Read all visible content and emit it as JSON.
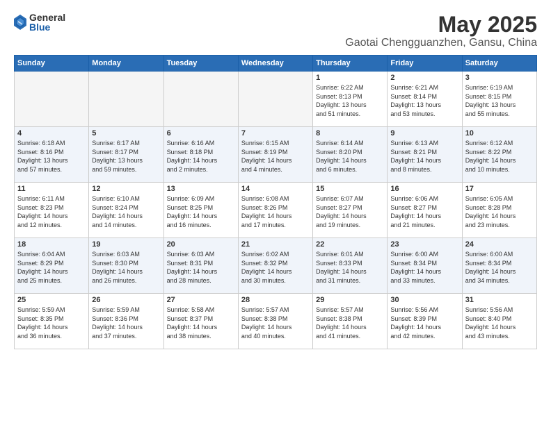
{
  "logo": {
    "general": "General",
    "blue": "Blue"
  },
  "title": "May 2025",
  "location": "Gaotai Chengguanzhen, Gansu, China",
  "headers": [
    "Sunday",
    "Monday",
    "Tuesday",
    "Wednesday",
    "Thursday",
    "Friday",
    "Saturday"
  ],
  "weeks": [
    [
      {
        "day": "",
        "content": ""
      },
      {
        "day": "",
        "content": ""
      },
      {
        "day": "",
        "content": ""
      },
      {
        "day": "",
        "content": ""
      },
      {
        "day": "1",
        "content": "Sunrise: 6:22 AM\nSunset: 8:13 PM\nDaylight: 13 hours\nand 51 minutes."
      },
      {
        "day": "2",
        "content": "Sunrise: 6:21 AM\nSunset: 8:14 PM\nDaylight: 13 hours\nand 53 minutes."
      },
      {
        "day": "3",
        "content": "Sunrise: 6:19 AM\nSunset: 8:15 PM\nDaylight: 13 hours\nand 55 minutes."
      }
    ],
    [
      {
        "day": "4",
        "content": "Sunrise: 6:18 AM\nSunset: 8:16 PM\nDaylight: 13 hours\nand 57 minutes."
      },
      {
        "day": "5",
        "content": "Sunrise: 6:17 AM\nSunset: 8:17 PM\nDaylight: 13 hours\nand 59 minutes."
      },
      {
        "day": "6",
        "content": "Sunrise: 6:16 AM\nSunset: 8:18 PM\nDaylight: 14 hours\nand 2 minutes."
      },
      {
        "day": "7",
        "content": "Sunrise: 6:15 AM\nSunset: 8:19 PM\nDaylight: 14 hours\nand 4 minutes."
      },
      {
        "day": "8",
        "content": "Sunrise: 6:14 AM\nSunset: 8:20 PM\nDaylight: 14 hours\nand 6 minutes."
      },
      {
        "day": "9",
        "content": "Sunrise: 6:13 AM\nSunset: 8:21 PM\nDaylight: 14 hours\nand 8 minutes."
      },
      {
        "day": "10",
        "content": "Sunrise: 6:12 AM\nSunset: 8:22 PM\nDaylight: 14 hours\nand 10 minutes."
      }
    ],
    [
      {
        "day": "11",
        "content": "Sunrise: 6:11 AM\nSunset: 8:23 PM\nDaylight: 14 hours\nand 12 minutes."
      },
      {
        "day": "12",
        "content": "Sunrise: 6:10 AM\nSunset: 8:24 PM\nDaylight: 14 hours\nand 14 minutes."
      },
      {
        "day": "13",
        "content": "Sunrise: 6:09 AM\nSunset: 8:25 PM\nDaylight: 14 hours\nand 16 minutes."
      },
      {
        "day": "14",
        "content": "Sunrise: 6:08 AM\nSunset: 8:26 PM\nDaylight: 14 hours\nand 17 minutes."
      },
      {
        "day": "15",
        "content": "Sunrise: 6:07 AM\nSunset: 8:27 PM\nDaylight: 14 hours\nand 19 minutes."
      },
      {
        "day": "16",
        "content": "Sunrise: 6:06 AM\nSunset: 8:27 PM\nDaylight: 14 hours\nand 21 minutes."
      },
      {
        "day": "17",
        "content": "Sunrise: 6:05 AM\nSunset: 8:28 PM\nDaylight: 14 hours\nand 23 minutes."
      }
    ],
    [
      {
        "day": "18",
        "content": "Sunrise: 6:04 AM\nSunset: 8:29 PM\nDaylight: 14 hours\nand 25 minutes."
      },
      {
        "day": "19",
        "content": "Sunrise: 6:03 AM\nSunset: 8:30 PM\nDaylight: 14 hours\nand 26 minutes."
      },
      {
        "day": "20",
        "content": "Sunrise: 6:03 AM\nSunset: 8:31 PM\nDaylight: 14 hours\nand 28 minutes."
      },
      {
        "day": "21",
        "content": "Sunrise: 6:02 AM\nSunset: 8:32 PM\nDaylight: 14 hours\nand 30 minutes."
      },
      {
        "day": "22",
        "content": "Sunrise: 6:01 AM\nSunset: 8:33 PM\nDaylight: 14 hours\nand 31 minutes."
      },
      {
        "day": "23",
        "content": "Sunrise: 6:00 AM\nSunset: 8:34 PM\nDaylight: 14 hours\nand 33 minutes."
      },
      {
        "day": "24",
        "content": "Sunrise: 6:00 AM\nSunset: 8:34 PM\nDaylight: 14 hours\nand 34 minutes."
      }
    ],
    [
      {
        "day": "25",
        "content": "Sunrise: 5:59 AM\nSunset: 8:35 PM\nDaylight: 14 hours\nand 36 minutes."
      },
      {
        "day": "26",
        "content": "Sunrise: 5:59 AM\nSunset: 8:36 PM\nDaylight: 14 hours\nand 37 minutes."
      },
      {
        "day": "27",
        "content": "Sunrise: 5:58 AM\nSunset: 8:37 PM\nDaylight: 14 hours\nand 38 minutes."
      },
      {
        "day": "28",
        "content": "Sunrise: 5:57 AM\nSunset: 8:38 PM\nDaylight: 14 hours\nand 40 minutes."
      },
      {
        "day": "29",
        "content": "Sunrise: 5:57 AM\nSunset: 8:38 PM\nDaylight: 14 hours\nand 41 minutes."
      },
      {
        "day": "30",
        "content": "Sunrise: 5:56 AM\nSunset: 8:39 PM\nDaylight: 14 hours\nand 42 minutes."
      },
      {
        "day": "31",
        "content": "Sunrise: 5:56 AM\nSunset: 8:40 PM\nDaylight: 14 hours\nand 43 minutes."
      }
    ]
  ]
}
